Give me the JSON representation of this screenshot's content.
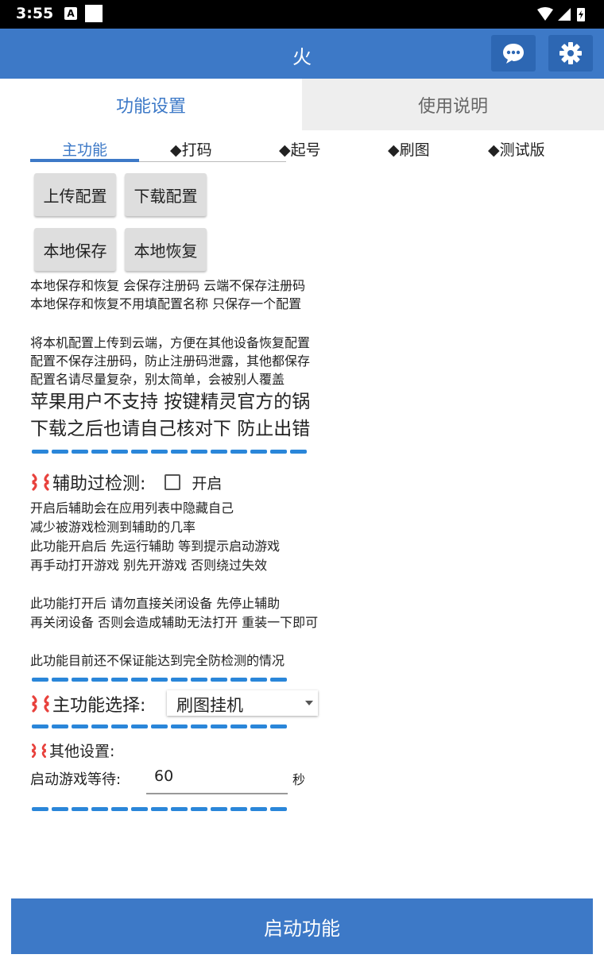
{
  "status_bar": {
    "time": "3:55",
    "notification_icon": "A"
  },
  "app": {
    "title": "火"
  },
  "tabs": [
    {
      "label": "功能设置",
      "active": true
    },
    {
      "label": "使用说明",
      "active": false
    }
  ],
  "subtabs": [
    {
      "label": "主功能",
      "active": true
    },
    {
      "label": "◆打码"
    },
    {
      "label": "◆起号"
    },
    {
      "label": "◆刷图"
    },
    {
      "label": "◆测试版"
    }
  ],
  "buttons": {
    "upload": "上传配置",
    "download": "下载配置",
    "local_save": "本地保存",
    "local_restore": "本地恢复",
    "start": "启动功能"
  },
  "info": {
    "local_lines": [
      "本地保存和恢复 会保存注册码 云端不保存注册码",
      "本地保存和恢复不用填配置名称 只保存一个配置"
    ],
    "cloud_lines": [
      "将本机配置上传到云端，方便在其他设备恢复配置",
      "配置不保存注册码，防止注册码泄露，其他都保存",
      "配置名请尽量复杂，别太简单，会被别人覆盖"
    ],
    "big_lines": [
      "苹果用户不支持 按键精灵官方的锅",
      "下载之后也请自己核对下 防止出错"
    ]
  },
  "detection": {
    "title": "辅助过检测:",
    "checkbox_label": "开启",
    "checked": false,
    "lines_a": [
      "开启后辅助会在应用列表中隐藏自己",
      "减少被游戏检测到辅助的几率",
      "此功能开启后 先运行辅助 等到提示启动游戏",
      "再手动打开游戏 别先开游戏 否则绕过失效"
    ],
    "lines_b": [
      "此功能打开后 请勿直接关闭设备 先停止辅助",
      "再关闭设备 否则会造成辅助无法打开 重装一下即可"
    ],
    "line_c": "此功能目前还不保证能达到完全防检测的情况"
  },
  "main_function": {
    "title": "主功能选择:",
    "selected": "刷图挂机"
  },
  "other_settings": {
    "title": "其他设置:",
    "wait_label": "启动游戏等待:",
    "wait_value": "60",
    "wait_unit": "秒"
  },
  "colors": {
    "primary": "#3d79c7",
    "dash": "#2a86d9",
    "burst": "#e8413c"
  }
}
